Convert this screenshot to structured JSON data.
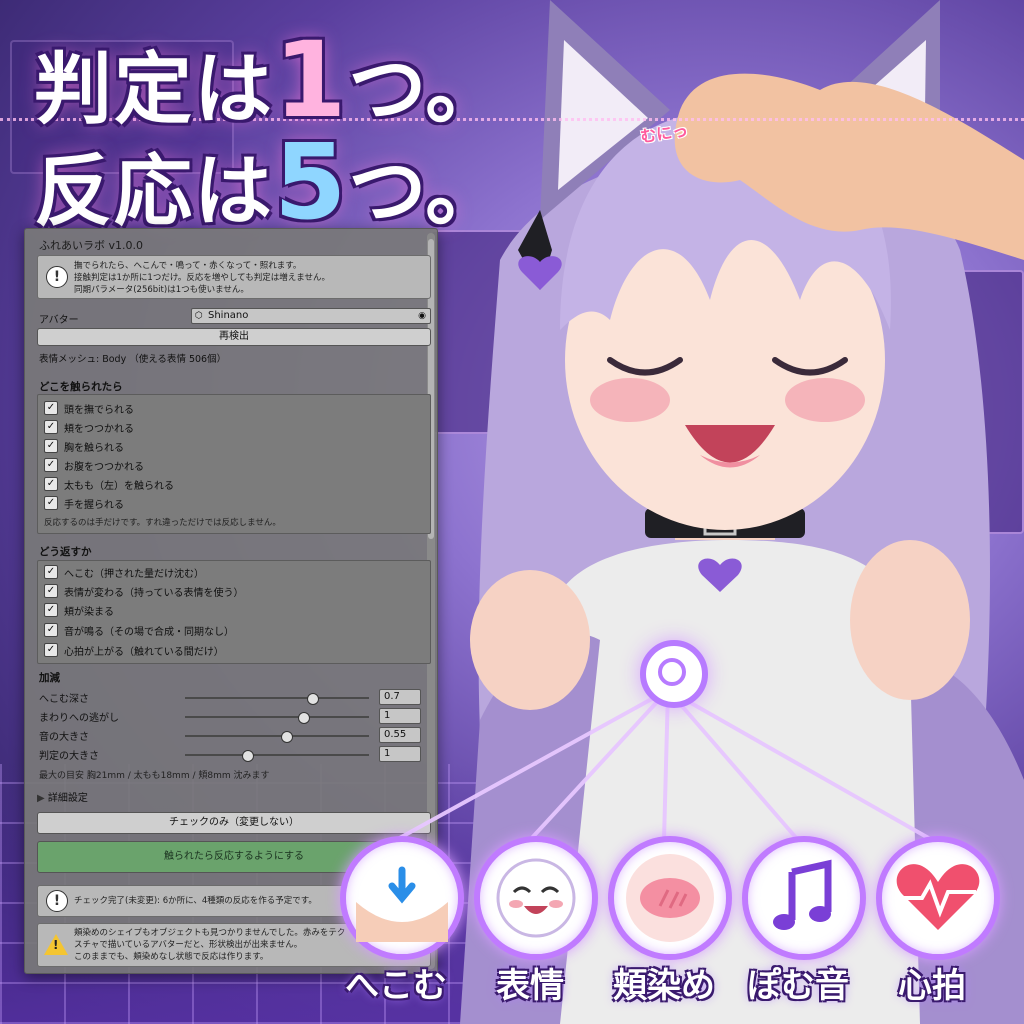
{
  "headline": {
    "line1_prefix": "判定は",
    "line1_num": "1",
    "line1_suffix": "つ。",
    "line2_prefix": "反応は",
    "line2_num": "5",
    "line2_suffix": "つ。"
  },
  "sfx": "むにっ",
  "colors": {
    "panel_bg": "#787878",
    "accent_purple": "#c07bff",
    "apply_green": "#6aa36c",
    "warn_yellow": "#f4c531"
  },
  "panel": {
    "title": "ふれあいラボ v1.0.0",
    "intro_help": {
      "icon": "info-icon",
      "lines": [
        "撫でられたら、へこんで・鳴って・赤くなって・照れます。",
        "接触判定は1か所に1つだけ。反応を増やしても判定は増えません。",
        "同期パラメータ(256bit)は1つも使いません。"
      ]
    },
    "avatar_label": "アバター",
    "avatar_value": "Shinano",
    "rescan_button": "再検出",
    "mesh_info": "表情メッシュ: Body （使える表情 506個）",
    "touch_section": {
      "title": "どこを触られたら",
      "items": [
        "頭を撫でられる",
        "頬をつつかれる",
        "胸を触られる",
        "お腹をつつかれる",
        "太もも（左）を触られる",
        "手を握られる"
      ],
      "note": "反応するのは手だけです。すれ違っただけでは反応しません。"
    },
    "reaction_section": {
      "title": "どう返すか",
      "items": [
        "へこむ（押された量だけ沈む）",
        "表情が変わる（持っている表情を使う）",
        "頬が染まる",
        "音が鳴る（その場で合成・同期なし）",
        "心拍が上がる（触れている間だけ）"
      ]
    },
    "adjust_section": {
      "title": "加減",
      "sliders": [
        {
          "label": "へこむ深さ",
          "value": "0.7",
          "fraction": 0.7
        },
        {
          "label": "まわりへの逃がし",
          "value": "1",
          "fraction": 0.65
        },
        {
          "label": "音の大きさ",
          "value": "0.55",
          "fraction": 0.55
        },
        {
          "label": "判定の大きさ",
          "value": "1",
          "fraction": 0.33
        }
      ],
      "note": "最大の目安 胸21mm / 太もも18mm / 頬8mm 沈みます"
    },
    "advanced_foldout": "詳細設定",
    "check_only_button": "チェックのみ（変更しない）",
    "apply_button": "触られたら反応するようにする",
    "result_help": {
      "icon": "info-icon",
      "text": "チェック完了(未変更): 6か所に、4種類の反応を作る予定です。"
    },
    "warning_help": {
      "icon": "warning-icon",
      "lines": [
        "頬染めのシェイプもオブジェクトも見つかりませんでした。赤みをテク",
        "スチャで描いているアバターだと、形状検出が出来ません。",
        "このままでも、頬染めなし状態で反応は作ります。"
      ]
    }
  },
  "reactions": [
    {
      "label": "へこむ",
      "icon": "dent-arrow-icon"
    },
    {
      "label": "表情",
      "icon": "smiling-face-icon"
    },
    {
      "label": "頬染め",
      "icon": "blush-icon"
    },
    {
      "label": "ぽむ音",
      "icon": "music-note-icon"
    },
    {
      "label": "心拍",
      "icon": "heartbeat-icon"
    }
  ]
}
